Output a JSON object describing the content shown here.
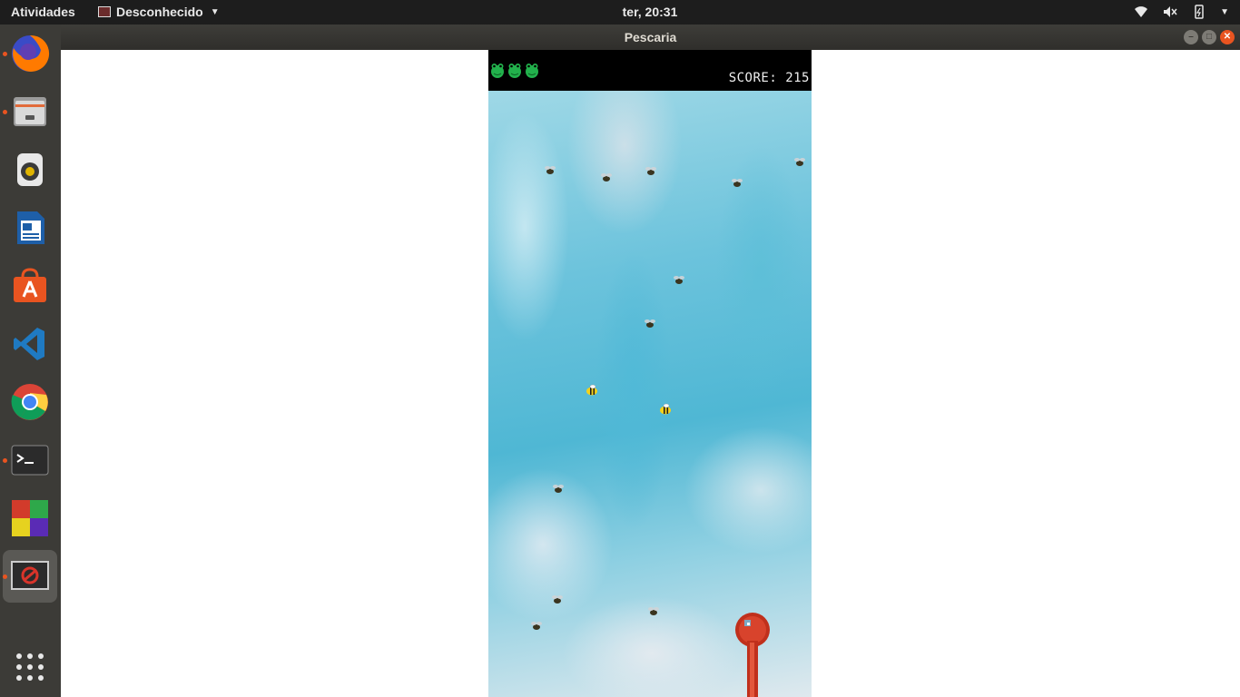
{
  "topbar": {
    "activities": "Atividades",
    "app_menu": "Desconhecido",
    "clock": "ter, 20:31"
  },
  "dock": {
    "items": [
      {
        "name": "firefox-icon",
        "running": true
      },
      {
        "name": "files-icon",
        "running": true
      },
      {
        "name": "rhythmbox-icon",
        "running": false
      },
      {
        "name": "writer-icon",
        "running": false
      },
      {
        "name": "software-icon",
        "running": false
      },
      {
        "name": "vscode-icon",
        "running": false
      },
      {
        "name": "chrome-icon",
        "running": false
      },
      {
        "name": "terminal-icon",
        "running": true
      },
      {
        "name": "blocks-app-icon",
        "running": false
      },
      {
        "name": "game-window-icon",
        "running": true
      }
    ],
    "show_apps": "apps-grid-icon"
  },
  "window": {
    "title": "Pescaria"
  },
  "game": {
    "lives": 3,
    "score_label": "SCORE: 215"
  },
  "colors": {
    "accent": "#e95420",
    "frog": "#22b14c",
    "hook": "#c0301c"
  }
}
